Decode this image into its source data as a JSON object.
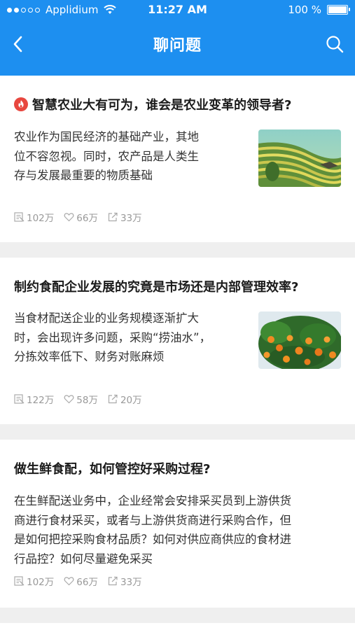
{
  "status_bar": {
    "carrier": "Applidium",
    "time": "11:27 AM",
    "battery": "100 %"
  },
  "nav": {
    "title": "聊问题",
    "back_icon": "chevron-left-icon",
    "search_icon": "search-icon"
  },
  "articles": [
    {
      "title": "智慧农业大有可为，谁会是农业变革的领导者?",
      "hot": true,
      "summary_lines": [
        "农业作为国民经济的基础产业，其地",
        "位不容忽视。同时，农产品是人类生",
        "存与发展最重要的物质基础"
      ],
      "image": "rice-terrace-photo",
      "views": "102万",
      "likes": "66万",
      "shares": "33万"
    },
    {
      "title": "制约食配企业发展的究竟是市场还是内部管理效率?",
      "hot": false,
      "summary_lines": [
        "当食材配送企业的业务规模逐渐扩大",
        "时，会出现许多问题，采购“捞油水”，",
        "分拣效率低下、财务对账麻烦"
      ],
      "image": "orange-tree-photo",
      "views": "122万",
      "likes": "58万",
      "shares": "20万"
    },
    {
      "title": "做生鲜食配，如何管控好采购过程?",
      "hot": false,
      "summary_lines": [
        "在生鲜配送业务中，企业经常会安排采买员到上游供货",
        "商进行食材采买，或者与上游供货商进行采购合作，但",
        "是如何把控采购食材品质？如何对供应商供应的食材进",
        "行品控？如何尽量避免采买"
      ],
      "image": "",
      "views": "102万",
      "likes": "66万",
      "shares": "33万"
    }
  ]
}
